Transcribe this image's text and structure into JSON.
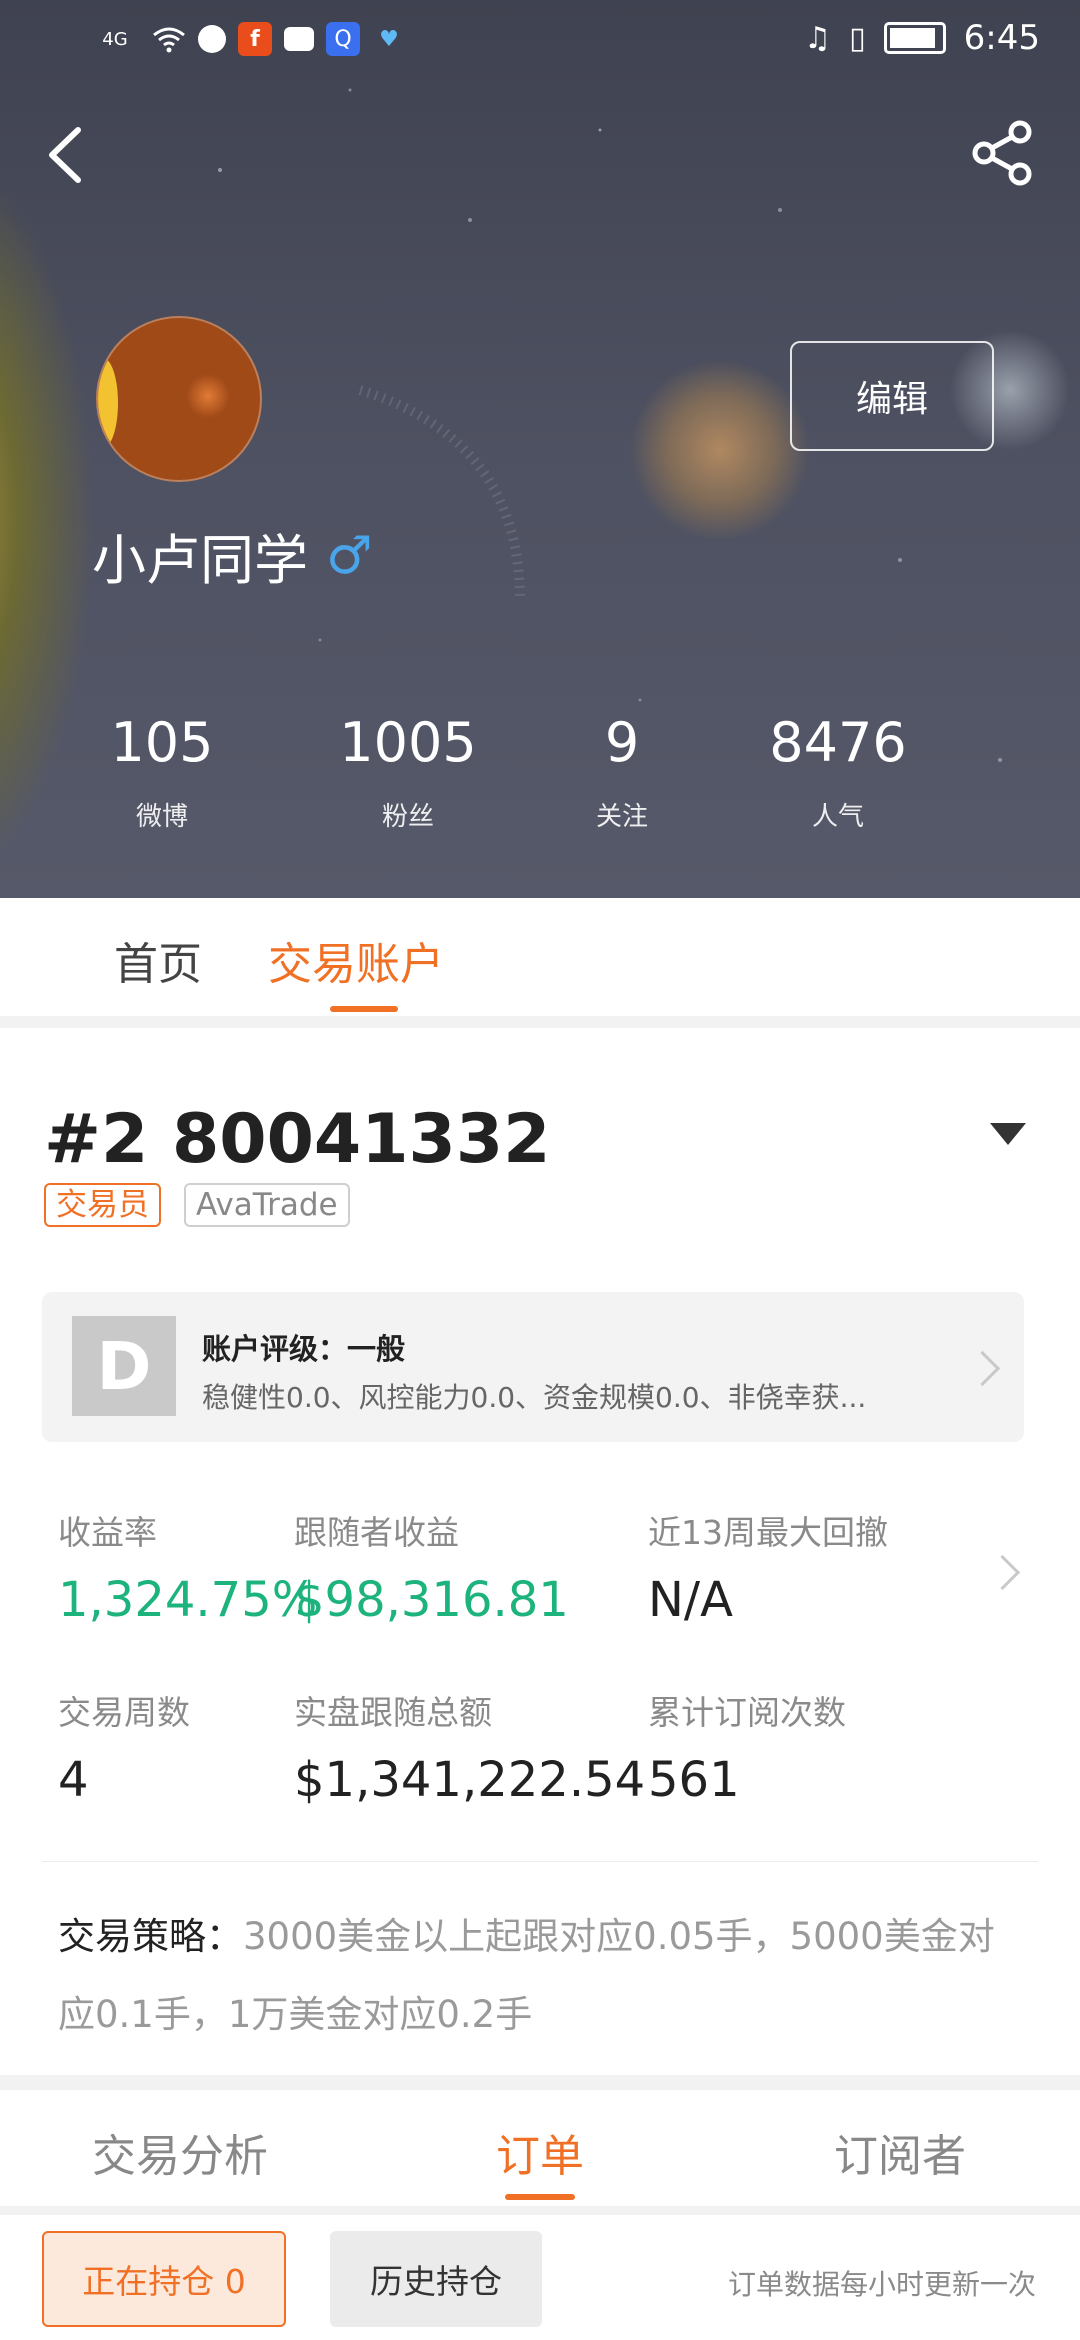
{
  "status_bar": {
    "network": "4G",
    "time": "6:45"
  },
  "profile": {
    "edit_label": "编辑",
    "username": "小卢同学",
    "gender_symbol": "♂",
    "stats": [
      {
        "value": "105",
        "label": "微博"
      },
      {
        "value": "1005",
        "label": "粉丝"
      },
      {
        "value": "9",
        "label": "关注"
      },
      {
        "value": "8476",
        "label": "人气"
      }
    ]
  },
  "top_tabs": [
    {
      "label": "首页",
      "active": false
    },
    {
      "label": "交易账户",
      "active": true
    }
  ],
  "account": {
    "title": "#2 80041332",
    "tags": [
      "交易员",
      "AvaTrade"
    ],
    "rating": {
      "grade": "D",
      "title": "账户评级：一般",
      "description": "稳健性0.0、风控能力0.0、资金规模0.0、非侥幸获..."
    },
    "metrics": [
      {
        "label": "收益率",
        "value": "1,324.75%"
      },
      {
        "label": "跟随者收益",
        "value": "$98,316.81"
      },
      {
        "label": "近13周最大回撤",
        "value": "N/A"
      },
      {
        "label": "交易周数",
        "value": "4"
      },
      {
        "label": "实盘跟随总额",
        "value": "$1,341,222.54"
      },
      {
        "label": "累计订阅次数",
        "value": "561"
      }
    ],
    "strategy_label": "交易策略：",
    "strategy_text": "3000美金以上起跟对应0.05手，5000美金对应0.1手，1万美金对应0.2手"
  },
  "bottom_tabs": [
    {
      "label": "交易分析",
      "active": false
    },
    {
      "label": "订单",
      "active": true
    },
    {
      "label": "订阅者",
      "active": false
    }
  ],
  "footer": {
    "holding_label": "正在持仓 0",
    "history_label": "历史持仓",
    "note": "订单数据每小时更新一次"
  },
  "colors": {
    "accent": "#f07126",
    "positive": "#1db37d",
    "gender": "#4aa4ea"
  }
}
